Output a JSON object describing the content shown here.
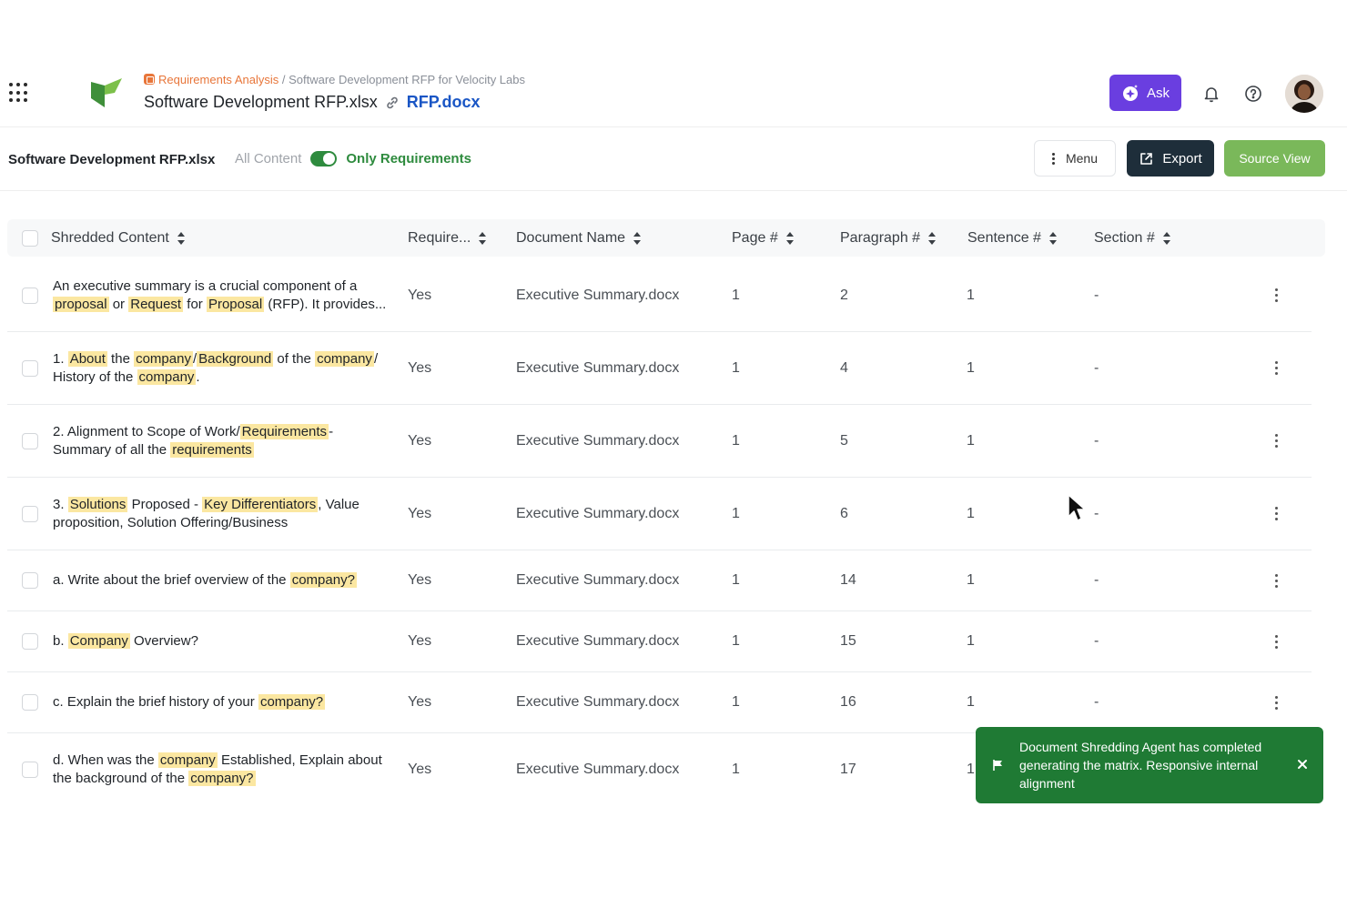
{
  "header": {
    "breadcrumb_link": "Requirements Analysis",
    "breadcrumb_sep": "/",
    "breadcrumb_current": "Software Development RFP for Velocity Labs",
    "file_title": "Software Development RFP.xlsx",
    "linked_doc": "RFP.docx",
    "ask_label": "Ask",
    "colors": {
      "ask": "#6a3ee0",
      "brand_green": "#2e8b3e",
      "link_blue": "#1a56c5"
    }
  },
  "toolbar": {
    "file_name": "Software Development RFP.xlsx",
    "all_content_label": "All Content",
    "only_requirements_label": "Only Requirements",
    "toggle_on": true,
    "menu_label": "Menu",
    "export_label": "Export",
    "source_view_label": "Source View"
  },
  "table": {
    "columns": [
      "Shredded Content",
      "Require...",
      "Document Name",
      "Page #",
      "Paragraph #",
      "Sentence #",
      "Section #"
    ],
    "rows": [
      {
        "segments": [
          {
            "t": "An executive summary is a crucial component of a ",
            "h": false
          },
          {
            "t": "proposal",
            "h": true
          },
          {
            "t": " or ",
            "h": false
          },
          {
            "t": "Request",
            "h": true
          },
          {
            "t": " for ",
            "h": false
          },
          {
            "t": "Proposal",
            "h": true
          },
          {
            "t": " (RFP). It provides...",
            "h": false
          }
        ],
        "requirement": "Yes",
        "document": "Executive Summary.docx",
        "page": "1",
        "paragraph": "2",
        "sentence": "1",
        "section": "-"
      },
      {
        "segments": [
          {
            "t": "1. ",
            "h": false
          },
          {
            "t": "About",
            "h": true
          },
          {
            "t": " the ",
            "h": false
          },
          {
            "t": "company",
            "h": true
          },
          {
            "t": "/",
            "h": false
          },
          {
            "t": "Background",
            "h": true
          },
          {
            "t": " of the ",
            "h": false
          },
          {
            "t": "company",
            "h": true
          },
          {
            "t": "/ History of the ",
            "h": false
          },
          {
            "t": "company",
            "h": true
          },
          {
            "t": ".",
            "h": false
          }
        ],
        "requirement": "Yes",
        "document": "Executive Summary.docx",
        "page": "1",
        "paragraph": "4",
        "sentence": "1",
        "section": "-"
      },
      {
        "segments": [
          {
            "t": "2. Alignment to Scope of Work/",
            "h": false
          },
          {
            "t": "Requirements",
            "h": true
          },
          {
            "t": "- Summary of all the ",
            "h": false
          },
          {
            "t": "requirements",
            "h": true
          }
        ],
        "requirement": "Yes",
        "document": "Executive Summary.docx",
        "page": "1",
        "paragraph": "5",
        "sentence": "1",
        "section": "-"
      },
      {
        "segments": [
          {
            "t": "3. ",
            "h": false
          },
          {
            "t": "Solutions",
            "h": true
          },
          {
            "t": " Proposed - ",
            "h": false
          },
          {
            "t": "Key Differentiators",
            "h": true
          },
          {
            "t": ", Value proposition, Solution Offering/Business",
            "h": false
          }
        ],
        "requirement": "Yes",
        "document": "Executive Summary.docx",
        "page": "1",
        "paragraph": "6",
        "sentence": "1",
        "section": "-"
      },
      {
        "segments": [
          {
            "t": "a. Write about the brief overview of the ",
            "h": false
          },
          {
            "t": "company?",
            "h": true
          }
        ],
        "requirement": "Yes",
        "document": "Executive Summary.docx",
        "page": "1",
        "paragraph": "14",
        "sentence": "1",
        "section": "-"
      },
      {
        "segments": [
          {
            "t": "b. ",
            "h": false
          },
          {
            "t": "Company",
            "h": true
          },
          {
            "t": " Overview?",
            "h": false
          }
        ],
        "requirement": "Yes",
        "document": "Executive Summary.docx",
        "page": "1",
        "paragraph": "15",
        "sentence": "1",
        "section": "-"
      },
      {
        "segments": [
          {
            "t": "c. Explain the brief history of your ",
            "h": false
          },
          {
            "t": "company?",
            "h": true
          }
        ],
        "requirement": "Yes",
        "document": "Executive Summary.docx",
        "page": "1",
        "paragraph": "16",
        "sentence": "1",
        "section": "-"
      },
      {
        "segments": [
          {
            "t": "d. When was the ",
            "h": false
          },
          {
            "t": "company",
            "h": true
          },
          {
            "t": " Established, Explain about the background of the ",
            "h": false
          },
          {
            "t": "company?",
            "h": true
          }
        ],
        "requirement": "Yes",
        "document": "Executive Summary.docx",
        "page": "1",
        "paragraph": "17",
        "sentence": "1",
        "section": ""
      }
    ]
  },
  "toast": {
    "message": "Document Shredding Agent has completed generating the matrix. Responsive internal alignment",
    "color": "#1f7a34"
  }
}
